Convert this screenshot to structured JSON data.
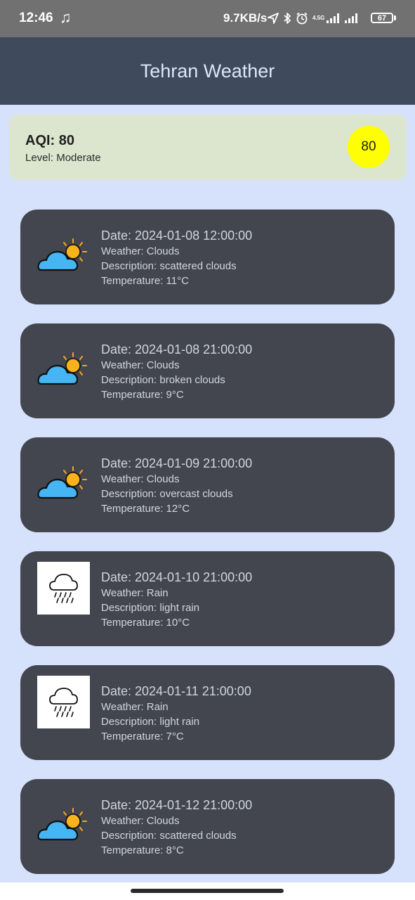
{
  "status_bar": {
    "time": "12:46",
    "net_speed": "9.7KB/s",
    "network_type": "4.5G",
    "battery": "67",
    "icons": [
      "music-note-icon",
      "location-arrow-icon",
      "bluetooth-icon",
      "alarm-icon",
      "signal-icon",
      "signal-icon",
      "battery-icon"
    ]
  },
  "app_bar": {
    "title": "Tehran Weather"
  },
  "aqi": {
    "value_label": "AQI: 80",
    "level_label": "Level: Moderate",
    "badge": "80",
    "badge_color": "#ffff00"
  },
  "forecasts": [
    {
      "icon": "cloud-sun-icon",
      "date": "Date: 2024-01-08 12:00:00",
      "weather": "Weather: Clouds",
      "description": "Description: scattered clouds",
      "temperature": "Temperature: 11°C"
    },
    {
      "icon": "cloud-sun-icon",
      "date": "Date: 2024-01-08 21:00:00",
      "weather": "Weather: Clouds",
      "description": "Description: broken clouds",
      "temperature": "Temperature: 9°C"
    },
    {
      "icon": "cloud-sun-icon",
      "date": "Date: 2024-01-09 21:00:00",
      "weather": "Weather: Clouds",
      "description": "Description: overcast clouds",
      "temperature": "Temperature: 12°C"
    },
    {
      "icon": "rain-cloud-icon",
      "date": "Date: 2024-01-10 21:00:00",
      "weather": "Weather: Rain",
      "description": "Description: light rain",
      "temperature": "Temperature: 10°C"
    },
    {
      "icon": "rain-cloud-icon",
      "date": "Date: 2024-01-11 21:00:00",
      "weather": "Weather: Rain",
      "description": "Description: light rain",
      "temperature": "Temperature: 7°C"
    },
    {
      "icon": "cloud-sun-icon",
      "date": "Date: 2024-01-12 21:00:00",
      "weather": "Weather: Clouds",
      "description": "Description: scattered clouds",
      "temperature": "Temperature: 8°C"
    }
  ],
  "colors": {
    "app_bar": "#3f4a5c",
    "background": "#d6e1fc",
    "card": "#43464e",
    "aqi_card": "#dce6cf"
  }
}
